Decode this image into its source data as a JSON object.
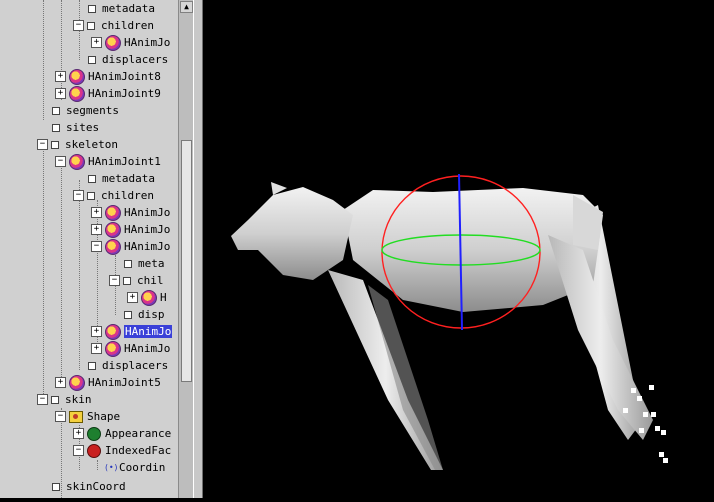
{
  "tree": {
    "rows": [
      {
        "label": "metadata"
      },
      {
        "label": "children"
      },
      {
        "label": "HAnimJo"
      },
      {
        "label": "displacers"
      },
      {
        "label": "HAnimJoint8"
      },
      {
        "label": "HAnimJoint9"
      },
      {
        "label": "segments"
      },
      {
        "label": "sites"
      },
      {
        "label": "skeleton"
      },
      {
        "label": "HAnimJoint1"
      },
      {
        "label": "metadata"
      },
      {
        "label": "children"
      },
      {
        "label": "HAnimJo"
      },
      {
        "label": "HAnimJo"
      },
      {
        "label": "HAnimJo"
      },
      {
        "label": "meta"
      },
      {
        "label": "chil"
      },
      {
        "label": "H"
      },
      {
        "label": "disp"
      },
      {
        "label": "HAnimJo"
      },
      {
        "label": "HAnimJo"
      },
      {
        "label": "displacers"
      },
      {
        "label": "HAnimJoint5"
      },
      {
        "label": "skin"
      },
      {
        "label": "Shape"
      },
      {
        "label": "Appearance"
      },
      {
        "label": "IndexedFac"
      },
      {
        "label": "Coordin"
      },
      {
        "label": "skinCoord"
      }
    ],
    "expander_plus": "+",
    "expander_minus": "−"
  },
  "scrollbar": {
    "up_arrow": "▲"
  },
  "viewport": {
    "model": "horse-skin-mesh",
    "manipulator_colors": {
      "ring": "#ff2020",
      "horizontal": "#22dd22",
      "axis": "#2020ff"
    },
    "background": "#000000"
  }
}
